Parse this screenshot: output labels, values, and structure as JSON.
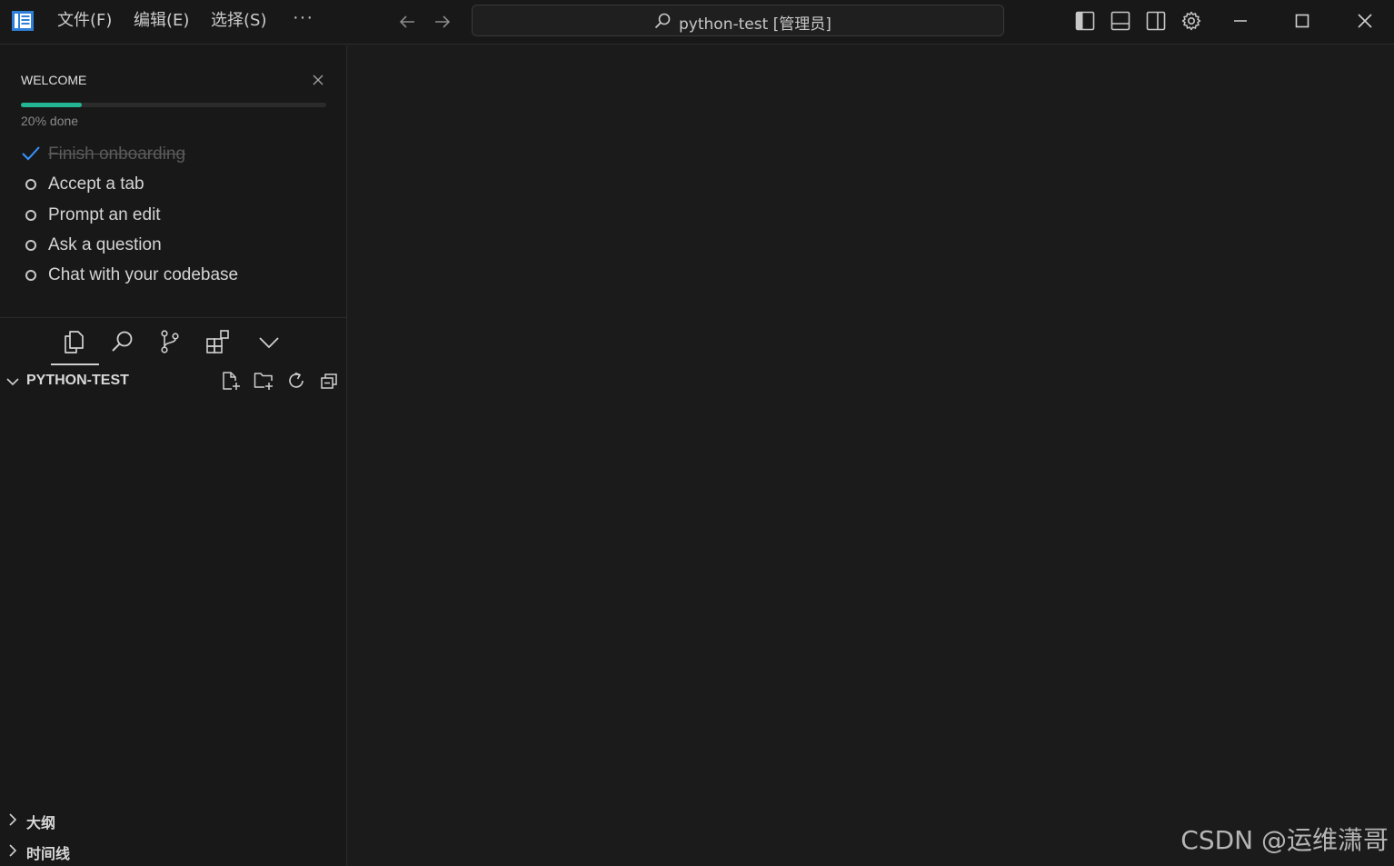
{
  "titlebar": {
    "menu": [
      "文件(F)",
      "编辑(E)",
      "选择(S)"
    ],
    "more_label": "···",
    "search_text": "python-test [管理员]"
  },
  "welcome": {
    "title": "WELCOME",
    "progress_percent": 20,
    "progress_text": "20% done",
    "tasks": [
      {
        "label": "Finish onboarding",
        "done": true
      },
      {
        "label": "Accept a tab",
        "done": false
      },
      {
        "label": "Prompt an edit",
        "done": false
      },
      {
        "label": "Ask a question",
        "done": false
      },
      {
        "label": "Chat with your codebase",
        "done": false
      }
    ]
  },
  "explorer": {
    "title": "PYTHON-TEST"
  },
  "panels": {
    "outline": "大纲",
    "timeline": "时间线"
  },
  "watermark": "CSDN @运维潇哥",
  "colors": {
    "accent": "#24b595",
    "check": "#3794ff",
    "background": "#1b1b1b",
    "sidebar": "#181818"
  }
}
